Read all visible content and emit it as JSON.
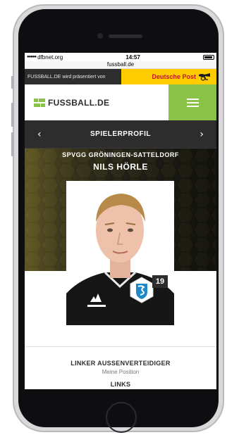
{
  "statusbar": {
    "carrier": "dfbnet.org",
    "time": "14:57"
  },
  "browser": {
    "url": "fussball.de"
  },
  "sponsor": {
    "text": "FUSSBALL.DE wird präsentiert von",
    "brand": "Deutsche Post"
  },
  "header": {
    "logo_text": "FUSSBALL.DE",
    "menu_color": "#8bc34a"
  },
  "nav": {
    "prev_label": "‹",
    "title": "SPIELERPROFIL",
    "next_label": "›"
  },
  "player": {
    "club": "SPVGG GRÖNINGEN-SATTELDORF",
    "name": "NILS HÖRLE",
    "number": "19",
    "position": "LINKER AUSSENVERTEIDIGER",
    "position_note": "Meine Position",
    "foot": "LINKS"
  },
  "colors": {
    "accent": "#8bc34a",
    "dark": "#2d2d2d",
    "sponsor_yellow": "#ffcc00",
    "sponsor_red": "#c8102e"
  },
  "icons": [
    "logo-icon",
    "post-horn-icon",
    "menu-icon",
    "chevron-left-icon",
    "chevron-right-icon",
    "club-crest-icon"
  ]
}
